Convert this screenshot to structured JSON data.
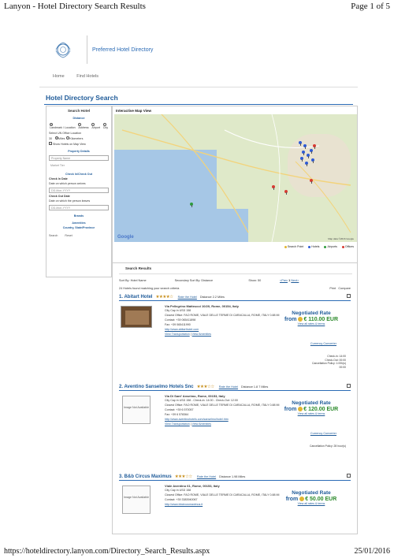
{
  "page_header": {
    "left": "Lanyon - Hotel Directory Search Results",
    "right": "Page 1 of 5"
  },
  "page_footer": {
    "left": "https://hoteldirectory.lanyon.com/Directory_Search_Results.aspx",
    "right": "25/01/2016"
  },
  "brand": {
    "name": "Preferred Hotel Directory"
  },
  "nav": {
    "home": "Home",
    "find_hotels": "Find Hotels"
  },
  "page_title": "Hotel Directory Search",
  "search": {
    "title": "Search Hotel",
    "distance_label": "Distance",
    "location_types": [
      {
        "label": "Landmark / Location",
        "selected": true
      },
      {
        "label": "Address",
        "selected": false
      },
      {
        "label": "Airport",
        "selected": false
      },
      {
        "label": "City",
        "selected": false
      }
    ],
    "select_office": "Select UN Office Location",
    "distance_value": "30",
    "units": [
      {
        "label": "Miles",
        "selected": true
      },
      {
        "label": "Kilometers",
        "selected": false
      }
    ],
    "show_map": "Show Hotels on Map View",
    "property_details": "Property Details",
    "property_name_placeholder": "Property Name",
    "market_tier": "Market Tier",
    "checkinout_label": "Check In/Check Out",
    "checkin_label": "Check In Date",
    "checkin_desc": "Date on which person arrives",
    "checkin_placeholder": "DD-Mon-YYYY",
    "checkout_label": "Check Out Date",
    "checkout_desc": "Date on which the person leaves",
    "checkout_placeholder": "DD-Mon-YYYY",
    "brands": "Brands",
    "amenities": "Amenities",
    "country": "Country, State/Province",
    "search_btn": "Search",
    "reset_btn": "Reset"
  },
  "map": {
    "title": "Interactive Map View",
    "google": "Google",
    "data": "Map data ©2016 Google",
    "legend": [
      "Search Point",
      "Hotels",
      "Airports",
      "Offices"
    ]
  },
  "results": {
    "title": "Search Results",
    "sort_by_label": "Sort By:",
    "sort_by_value": "Hotel Name",
    "secondary_label": "Secondary Sort By:",
    "secondary_value": "Distance",
    "show_label": "Show:",
    "show_value": "50",
    "prev": "<Prev",
    "page": "1",
    "next": "Next>",
    "found_text": "24 Hotels found matching your search criteria",
    "print": "Print",
    "compare": "Compare"
  },
  "hotels": [
    {
      "name": "1. Abitart Hotel",
      "rating": 4,
      "rate_link": "Rate the Hotel",
      "distance": "Distance 2.2 Miles",
      "address": "Via Pellegrino Matteucci 10/20, Rome, 00154, Italy",
      "city_cap": "City Cap in USD 158",
      "closest_office": "Closest Office: FAO ROME, VIALE DELLE TERME DI CARACALLA, ROME, ITALY 0.88 MI",
      "contact": "Contact: +39 065411898",
      "fax": "Fax: +39 065411990",
      "web": "http://www.abitarthotel.com",
      "view_transport": "View Transportation",
      "view_amenities": "View Amenities",
      "negotiated": "Negotiated Rate",
      "from": "from",
      "price": "€ 110.00 EUR",
      "view_all": "View all rates & terms",
      "currency": "Currency Converter",
      "checkin": "Check-in: 14:00",
      "checkout": "Check-Out: 00:00",
      "cancel": "Cancellation Policy: 1:00h(s)",
      "cancel_extra": "00:00"
    },
    {
      "name": "2. Aventino Sanselmo Hotels Snc",
      "rating": 3,
      "rate_link": "Rate the Hotel",
      "distance": "Distance 1.8 7 Miles",
      "address": "Via Di Sant' Anselmo, Rome, 00153, Italy",
      "city_cap": "City Cap in USD 158 - Check-in: 14:00 - Check-Out: 12:00",
      "closest_office": "Closest Office: FAO ROME, VIALE DELLE TERME DI CARACALLA, ROME, ITALY 0.88 MI",
      "contact": "Contact: +39 6 570057",
      "fax": "Fax: +39 6 578364",
      "web": "http://www.aventinohotels.com/sanselmo/hotel.htm",
      "view_transport": "View Transportation",
      "view_amenities": "View Amenities",
      "negotiated": "Negotiated Rate",
      "from": "from",
      "price": "€ 120.00 EUR",
      "view_all": "View all rates & terms",
      "currency": "Currency Converter",
      "cancel": "Cancellation Policy: 28 hour(s)",
      "no_image": "Image Not Available"
    },
    {
      "name": "3. B&b Circus Maximus",
      "rating": 3,
      "rate_link": "Rate the Hotel",
      "distance": "Distance 1.98 Miles",
      "address": "Viale Aventino 61, Rome, 00153, Italy",
      "city_cap": "City Cap in USD 158",
      "closest_office": "Closest Office: FAO ROME, VIALE DELLE TERME DI CARACALLA, ROME, ITALY 0.88 MI",
      "contact": "Contact: +39 3383940067",
      "web": "http://www.bbcircusmaximus.it",
      "negotiated": "Negotiated Rate",
      "from": "from",
      "price": "€ 50.00 EUR",
      "view_all": "View all rates & terms",
      "no_image": "Image Not Available"
    }
  ]
}
